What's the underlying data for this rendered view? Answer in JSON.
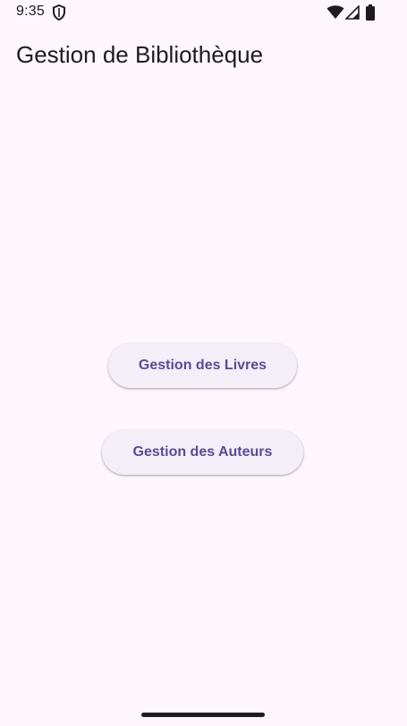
{
  "status_bar": {
    "time": "9:35",
    "left_icons": [
      "shield-icon"
    ],
    "right_icons": [
      "wifi-icon",
      "signal-icon",
      "battery-icon"
    ]
  },
  "app_bar": {
    "title": "Gestion de Bibliothèque"
  },
  "main": {
    "buttons": [
      {
        "label": "Gestion des Livres"
      },
      {
        "label": "Gestion des Auteurs"
      }
    ]
  },
  "colors": {
    "background": "#fdf7fd",
    "button_background": "#f4eef8",
    "button_text": "#5b4a94",
    "text_primary": "#1d1b20"
  }
}
